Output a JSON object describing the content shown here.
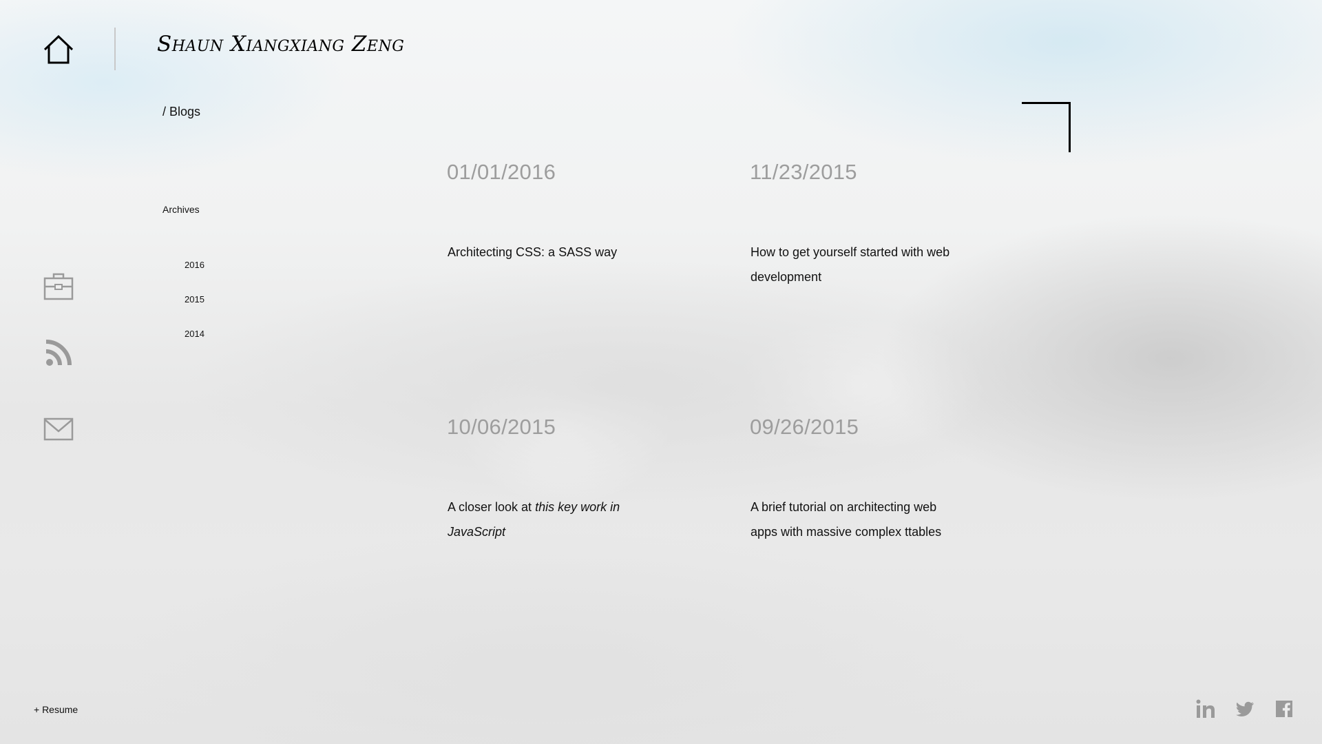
{
  "header": {
    "site_title": "Shaun Xiangxiang Zeng"
  },
  "breadcrumb": "/ Blogs",
  "sidebar": {
    "archives_label": "Archives",
    "years": [
      "2016",
      "2015",
      "2014"
    ]
  },
  "nav_icons": {
    "home": "home-icon",
    "portfolio": "briefcase-icon",
    "blog": "rss-icon",
    "contact": "mail-icon"
  },
  "posts": [
    {
      "date": "01/01/2016",
      "title_parts": [
        "Architecting CSS: a SASS way"
      ]
    },
    {
      "date": "11/23/2015",
      "title_parts": [
        "How to get yourself started with web development"
      ]
    },
    {
      "date": "10/06/2015",
      "title_parts": [
        "A closer look at ",
        "this key work in JavaScript"
      ]
    },
    {
      "date": "09/26/2015",
      "title_parts": [
        "A brief tutorial on architecting web apps with massive  complex ttables"
      ]
    }
  ],
  "footer": {
    "resume_label": "+ Resume",
    "social": [
      "linkedin-icon",
      "twitter-icon",
      "facebook-icon"
    ]
  },
  "colors": {
    "date_gray": "#9d9d9d",
    "icon_gray": "#9a9a9a",
    "text": "#111111"
  }
}
